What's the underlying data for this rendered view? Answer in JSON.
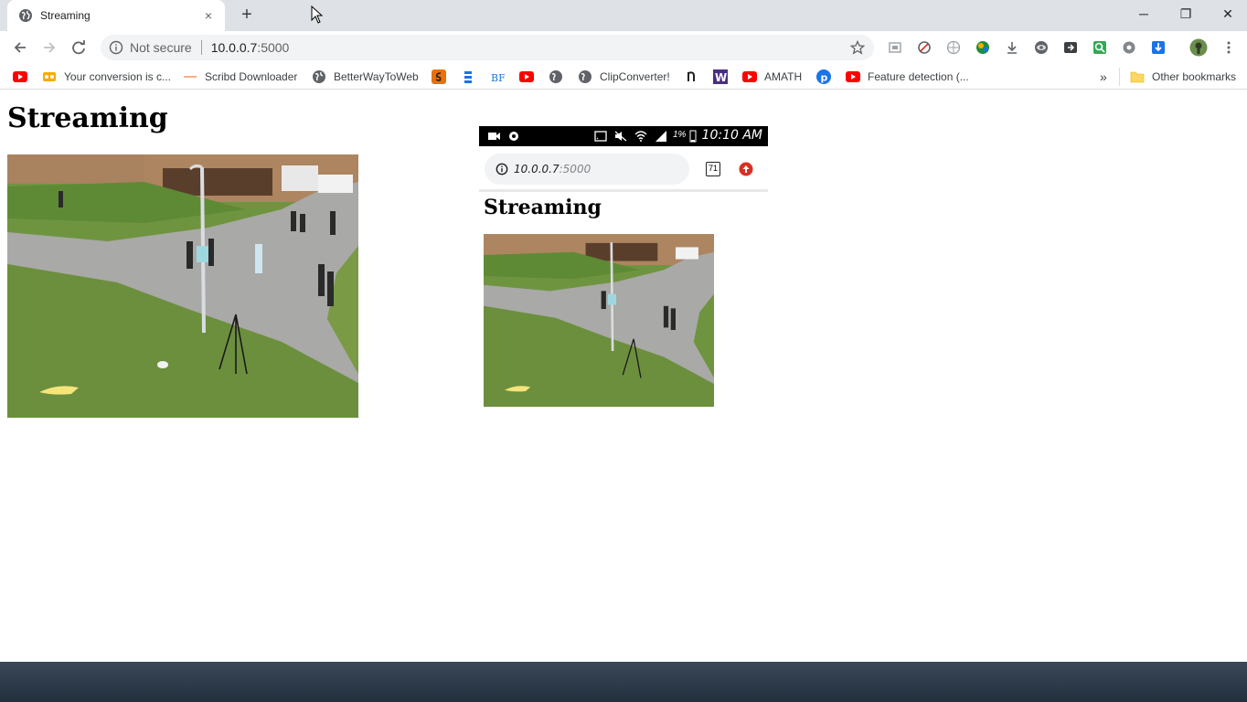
{
  "tab": {
    "title": "Streaming",
    "close": "×",
    "new_tab": "+"
  },
  "window_controls": {
    "minimize": "─",
    "restore": "❐",
    "close": "✕"
  },
  "omnibox": {
    "security_label": "Not secure",
    "url_host": "10.0.0.7",
    "url_port": ":5000"
  },
  "bookmarks": {
    "items": [
      {
        "label": "",
        "icon": "youtube-icon"
      },
      {
        "label": "Your conversion is c...",
        "icon": "conversion-icon"
      },
      {
        "label": "Scribd Downloader",
        "icon": "dash-icon"
      },
      {
        "label": "BetterWayToWeb",
        "icon": "globe-icon"
      },
      {
        "label": "",
        "icon": "orange-s-icon"
      },
      {
        "label": "",
        "icon": "stack-icon"
      },
      {
        "label": "",
        "icon": "bf-icon"
      },
      {
        "label": "",
        "icon": "youtube-icon"
      },
      {
        "label": "",
        "icon": "globe-icon"
      },
      {
        "label": "ClipConverter!",
        "icon": "globe-icon"
      },
      {
        "label": "",
        "icon": "n-icon"
      },
      {
        "label": "",
        "icon": "w-icon"
      },
      {
        "label": "AMATH",
        "icon": "youtube-icon"
      },
      {
        "label": "",
        "icon": "p-icon"
      },
      {
        "label": "Feature detection (...",
        "icon": "youtube-icon"
      }
    ],
    "overflow": "»",
    "other": "Other bookmarks"
  },
  "page": {
    "title": "Streaming"
  },
  "phone": {
    "time": "10:10 AM",
    "battery_pct": "1%",
    "url_host": "10.0.0.7",
    "url_port": ":5000",
    "tab_count": "71",
    "title": "Streaming"
  },
  "colors": {
    "tabstrip": "#dee1e6",
    "grass": "#6c8f3e",
    "road": "#a9a9a7",
    "brick": "#a9825f"
  }
}
